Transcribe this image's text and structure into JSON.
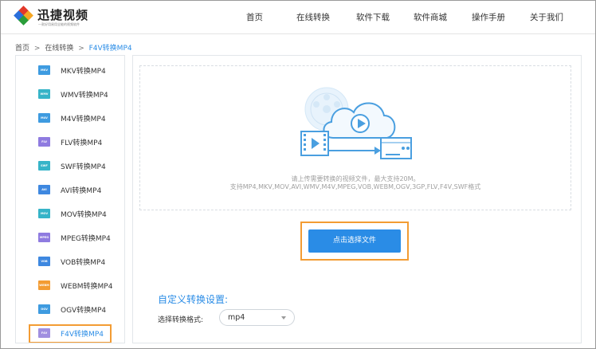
{
  "brand": {
    "name": "迅捷视频",
    "tagline": "一款好用易用全能的视频软件",
    "colors": [
      "#e2382a",
      "#f5a623",
      "#2a9d3a",
      "#2a6fdb"
    ]
  },
  "nav": {
    "items": [
      {
        "label": "首页"
      },
      {
        "label": "在线转换"
      },
      {
        "label": "软件下载"
      },
      {
        "label": "软件商城"
      },
      {
        "label": "操作手册"
      },
      {
        "label": "关于我们"
      }
    ]
  },
  "breadcrumb": {
    "home": "首页",
    "sep1": ">",
    "section": "在线转换",
    "sep2": ">",
    "current": "F4V转换MP4"
  },
  "sidebar": {
    "items": [
      {
        "icon": "MKV",
        "label": "MKV转换MP4",
        "color": "#3e9be0"
      },
      {
        "icon": "WMV",
        "label": "WMV转换MP4",
        "color": "#36b4c8"
      },
      {
        "icon": "M4V",
        "label": "M4V转换MP4",
        "color": "#3e9be0"
      },
      {
        "icon": "FLV",
        "label": "FLV转换MP4",
        "color": "#8f7be0"
      },
      {
        "icon": "SWF",
        "label": "SWF转换MP4",
        "color": "#36b4c8"
      },
      {
        "icon": "AVI",
        "label": "AVI转换MP4",
        "color": "#3e88e0"
      },
      {
        "icon": "MOV",
        "label": "MOV转换MP4",
        "color": "#36b4c8"
      },
      {
        "icon": "MPEG",
        "label": "MPEG转换MP4",
        "color": "#8f7be0"
      },
      {
        "icon": "VOB",
        "label": "VOB转换MP4",
        "color": "#3e88e0"
      },
      {
        "icon": "WEBM",
        "label": "WEBM转换MP4",
        "color": "#f39c33"
      },
      {
        "icon": "OGV",
        "label": "OGV转换MP4",
        "color": "#3e9be0"
      },
      {
        "icon": "F4V",
        "label": "F4V转换MP4",
        "color": "#a08fe0"
      }
    ],
    "active_index": 11
  },
  "upload": {
    "hint": "请上传需要转换的视频文件，最大支持20M。",
    "formats": "支持MP4,MKV,MOV,AVI,WMV,M4V,MPEG,VOB,WEBM,OGV,3GP,FLV,F4V,SWF格式",
    "button_label": "点击选择文件",
    "accent": "#2a8ce6",
    "highlight": "#f39c33"
  },
  "settings": {
    "title": "自定义转换设置:",
    "format_label": "选择转换格式:",
    "format_value": "mp4"
  }
}
